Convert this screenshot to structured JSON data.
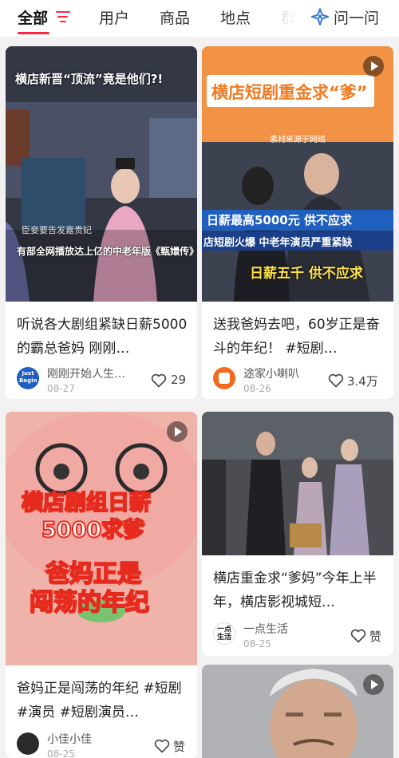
{
  "tabs": [
    "全部",
    "用户",
    "商品",
    "地点",
    "群"
  ],
  "ask": "问一问",
  "colors": {
    "accent": "#ff2442",
    "thumb_orange": "#f08a3a"
  },
  "cards": [
    {
      "thumb_text_top": "横店新晋“顶流”竟是他们?!",
      "thumb_caption": "有部全网播放达上亿的中老年版《甄嬛传》",
      "thumb_sign": "臣妾要告发嘉贵妃",
      "title": "听说各大剧组紧缺日薪5000的霸总爸妈 刚刚…",
      "author": "刚刚开始人生…",
      "avatar_text": "Just Begin",
      "date": "08-27",
      "likes": "29"
    },
    {
      "thumb_banner": "横店短剧重金求“爹”",
      "thumb_source": "素材来源于网络",
      "thumb_line1": "日薪最高5000元 供不应求",
      "thumb_line2": "店短剧火爆 中老年演员严重紧缺",
      "thumb_line3": "日薪五千 供不应求",
      "title": "送我爸妈去吧，60岁正是奋斗的年纪！ #短剧…",
      "author": "途家小喇叭",
      "date": "08-26",
      "likes": "3.4万"
    },
    {
      "thumb_text1": "横店剧组日薪",
      "thumb_text2": "5000求爹",
      "thumb_text3": "爸妈正是",
      "thumb_text4": "闯荡的年纪",
      "title": "爸妈正是闯荡的年纪 #短剧 #演员 #短剧演员…",
      "author": "小佳小佳",
      "date": "08-25",
      "likes": "赞"
    },
    {
      "title": "横店重金求“爹妈”今年上半年，横店影视城短…",
      "author": "一点生活",
      "avatar_text": "一点生活",
      "date": "08-25",
      "likes": "赞"
    },
    {
      "title": ""
    }
  ]
}
